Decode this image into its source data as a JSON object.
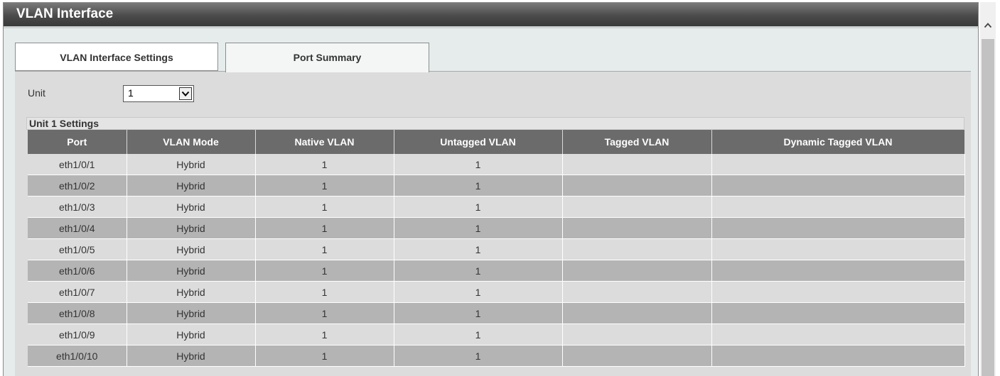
{
  "page": {
    "title": "VLAN Interface"
  },
  "tabs": [
    {
      "label": "VLAN Interface Settings",
      "active": false
    },
    {
      "label": "Port Summary",
      "active": true
    }
  ],
  "unit": {
    "label": "Unit",
    "selected": "1"
  },
  "section": {
    "title": "Unit 1 Settings"
  },
  "table": {
    "columns": [
      "Port",
      "VLAN Mode",
      "Native VLAN",
      "Untagged VLAN",
      "Tagged VLAN",
      "Dynamic Tagged VLAN"
    ],
    "rows": [
      [
        "eth1/0/1",
        "Hybrid",
        "1",
        "1",
        "",
        ""
      ],
      [
        "eth1/0/2",
        "Hybrid",
        "1",
        "1",
        "",
        ""
      ],
      [
        "eth1/0/3",
        "Hybrid",
        "1",
        "1",
        "",
        ""
      ],
      [
        "eth1/0/4",
        "Hybrid",
        "1",
        "1",
        "",
        ""
      ],
      [
        "eth1/0/5",
        "Hybrid",
        "1",
        "1",
        "",
        ""
      ],
      [
        "eth1/0/6",
        "Hybrid",
        "1",
        "1",
        "",
        ""
      ],
      [
        "eth1/0/7",
        "Hybrid",
        "1",
        "1",
        "",
        ""
      ],
      [
        "eth1/0/8",
        "Hybrid",
        "1",
        "1",
        "",
        ""
      ],
      [
        "eth1/0/9",
        "Hybrid",
        "1",
        "1",
        "",
        ""
      ],
      [
        "eth1/0/10",
        "Hybrid",
        "1",
        "1",
        "",
        ""
      ]
    ]
  },
  "icons": {
    "dropdown": "chevron-down-icon",
    "scroll_up": "chevron-up-icon"
  },
  "colors": {
    "title_bar": "#4b4b4b",
    "table_header": "#6b6b6b",
    "row_light": "#dcdcdc",
    "row_dark": "#b4b4b4"
  }
}
